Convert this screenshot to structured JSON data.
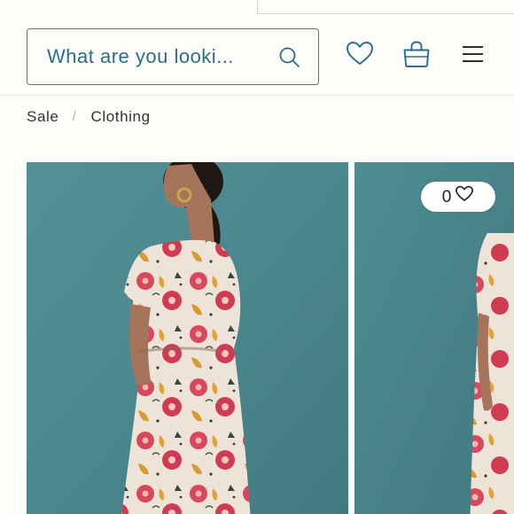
{
  "header": {
    "search": {
      "placeholder": "What are you looki..."
    },
    "icons": {
      "search": "search-icon",
      "wishlist": "heart-icon",
      "bag": "shopping-bag-icon",
      "menu": "hamburger-menu-icon"
    }
  },
  "breadcrumb": {
    "items": [
      {
        "label": "Sale"
      },
      {
        "label": "Clothing"
      }
    ],
    "separator": "/"
  },
  "products": [
    {
      "image_desc": "woman-in-floral-tiger-print-jumpsuit-back-view"
    },
    {
      "favorites_count": "0",
      "image_desc": "woman-in-floral-tiger-print-jumpsuit-front-view"
    }
  ],
  "colors": {
    "accent": "#2a6e8c",
    "background": "#fefdf9",
    "image_backdrop": "#4a8a93"
  }
}
